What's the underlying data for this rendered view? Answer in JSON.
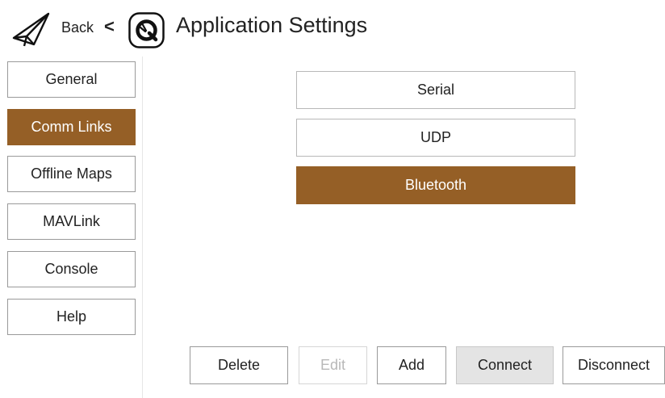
{
  "header": {
    "back_label": "Back",
    "chevron": "<",
    "title": "Application Settings",
    "icons": [
      "paper-plane-icon",
      "qgc-logo-icon"
    ]
  },
  "sidebar": {
    "items": [
      {
        "label": "General",
        "active": false
      },
      {
        "label": "Comm Links",
        "active": true
      },
      {
        "label": "Offline Maps",
        "active": false
      },
      {
        "label": "MAVLink",
        "active": false
      },
      {
        "label": "Console",
        "active": false
      },
      {
        "label": "Help",
        "active": false
      }
    ]
  },
  "links": {
    "items": [
      {
        "label": "Serial",
        "selected": false
      },
      {
        "label": "UDP",
        "selected": false
      },
      {
        "label": "Bluetooth",
        "selected": true
      }
    ]
  },
  "actions": {
    "delete": "Delete",
    "edit": "Edit",
    "add": "Add",
    "connect": "Connect",
    "disconnect": "Disconnect"
  },
  "colors": {
    "accent": "#955f26",
    "background": "#ffffff",
    "border": "#9a9a9a",
    "disabled_text": "#b8b8b8",
    "connect_bg": "#e4e4e4"
  }
}
